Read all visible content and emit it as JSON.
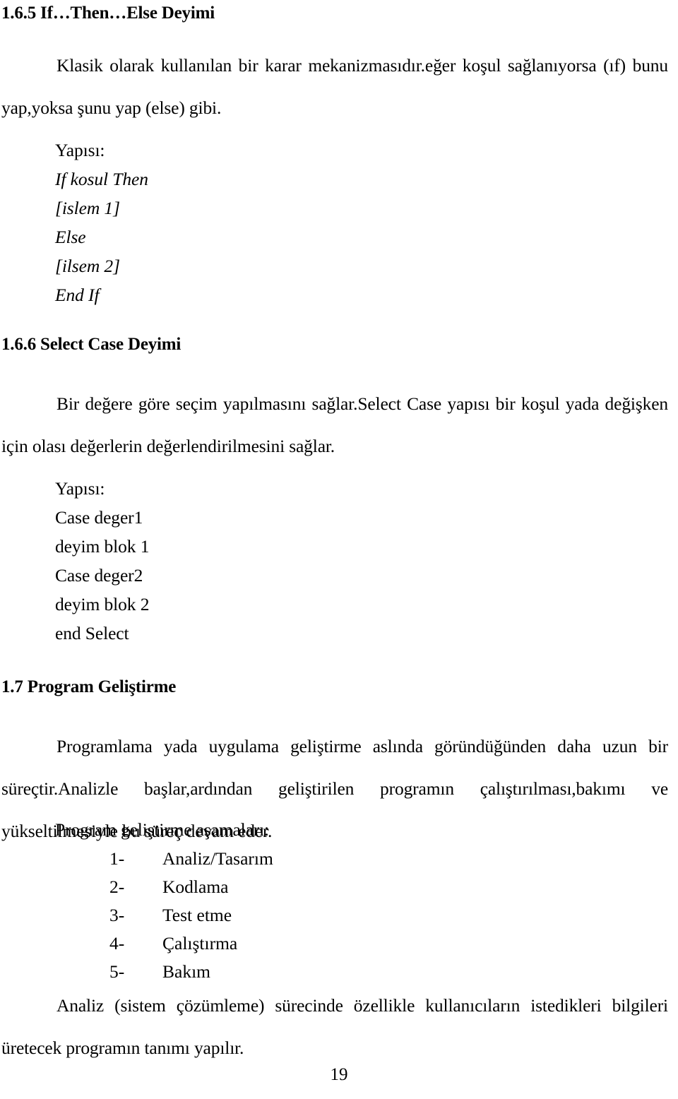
{
  "page": {
    "number": "19"
  },
  "sections": [
    {
      "id": "if-then-else",
      "heading": "1.6.5 If…Then…Else Deyimi",
      "paragraph": "Klasik olarak kullanılan bir karar mekanizmasıdır.eğer koşul sağlanıyorsa (ıf) bunu yap,yoksa şunu yap (else) gibi.",
      "structure_label": "Yapısı:",
      "structure_lines": [
        "If kosul Then",
        "[islem 1]",
        "Else",
        "[ilsem 2]",
        "End If"
      ]
    },
    {
      "id": "select-case",
      "heading": "1.6.6 Select Case Deyimi",
      "paragraph": "Bir değere göre seçim yapılmasını sağlar.Select Case yapısı bir koşul yada değişken için olası değerlerin değerlendirilmesini sağlar.",
      "structure_label": "Yapısı:",
      "structure_lines": [
        "Case deger1",
        "deyim blok 1",
        "Case deger2",
        "deyim blok 2",
        "end Select"
      ]
    },
    {
      "id": "program-gelistirme",
      "heading": "1.7 Program Geliştirme",
      "paragraph": "Programlama yada uygulama geliştirme aslında göründüğünden daha uzun bir süreçtir.Analizle başlar,ardından geliştirilen programın çalıştırılması,bakımı ve yükseltilmesiyle bu süreç devam eder.",
      "list_label": "Program geliştirme aşamaları:",
      "list_items": [
        {
          "num": "1-",
          "label": "Analiz/Tasarım"
        },
        {
          "num": "2-",
          "label": "Kodlama"
        },
        {
          "num": "3-",
          "label": "Test etme"
        },
        {
          "num": "4-",
          "label": "Çalıştırma"
        },
        {
          "num": "5-",
          "label": "Bakım"
        }
      ],
      "closing_paragraph": "Analiz (sistem çözümleme) sürecinde özellikle kullanıcıların istedikleri bilgileri üretecek programın tanımı yapılır."
    }
  ]
}
